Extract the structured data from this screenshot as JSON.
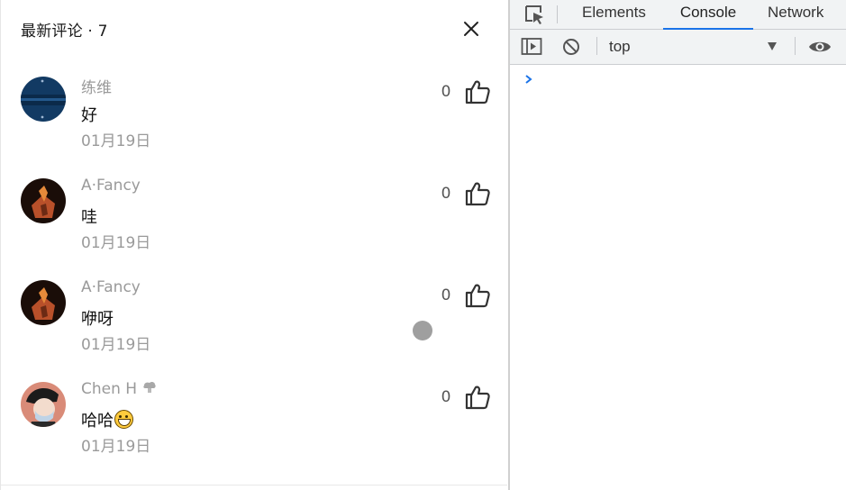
{
  "panel": {
    "title": "最新评论 · 7"
  },
  "comments": [
    {
      "author": "练维",
      "text": "好",
      "date": "01月19日",
      "likes": "0",
      "avatar": "avatar-dark-blue"
    },
    {
      "author": "A·Fancy",
      "text": "哇",
      "date": "01月19日",
      "likes": "0",
      "avatar": "avatar-dark-figure"
    },
    {
      "author": "A·Fancy",
      "text": "咿呀",
      "date": "01月19日",
      "likes": "0",
      "avatar": "avatar-dark-figure"
    },
    {
      "author": "Chen H",
      "text": "哈哈",
      "date": "01月19日",
      "likes": "0",
      "avatar": "avatar-masked-person",
      "has_badge": true,
      "emoji": "grinning-face"
    }
  ],
  "devtools": {
    "tabs": [
      "Elements",
      "Console",
      "Network"
    ],
    "active_tab": "Console",
    "context": "top",
    "accent": "#1a73e8"
  }
}
